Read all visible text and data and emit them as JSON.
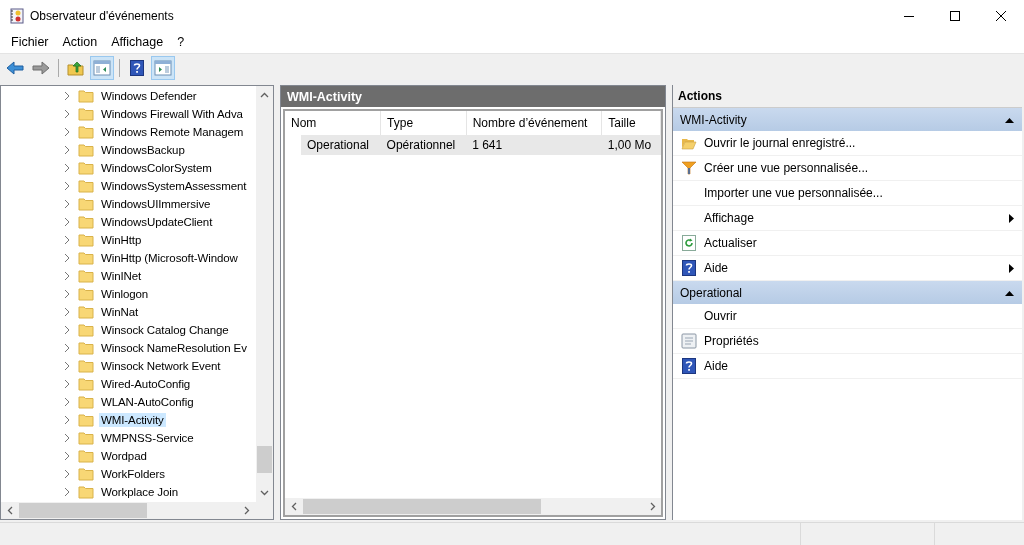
{
  "window": {
    "title": "Observateur d'événements"
  },
  "menu": [
    {
      "label": "Fichier"
    },
    {
      "label": "Action"
    },
    {
      "label": "Affichage"
    },
    {
      "label": "?"
    }
  ],
  "toolbar": [
    {
      "kind": "back"
    },
    {
      "kind": "forward"
    },
    {
      "kind": "separator"
    },
    {
      "kind": "up"
    },
    {
      "kind": "tree",
      "on": true
    },
    {
      "kind": "separator"
    },
    {
      "kind": "help"
    },
    {
      "kind": "pane",
      "on": true
    }
  ],
  "tree": {
    "items": [
      {
        "label": "Windows Defender",
        "expanded": false,
        "selected": false
      },
      {
        "label": "Windows Firewall With Adva",
        "expanded": false,
        "selected": false
      },
      {
        "label": "Windows Remote Managem",
        "expanded": false,
        "selected": false
      },
      {
        "label": "WindowsBackup",
        "expanded": false,
        "selected": false
      },
      {
        "label": "WindowsColorSystem",
        "expanded": false,
        "selected": false
      },
      {
        "label": "WindowsSystemAssessment",
        "expanded": false,
        "selected": false
      },
      {
        "label": "WindowsUIImmersive",
        "expanded": false,
        "selected": false
      },
      {
        "label": "WindowsUpdateClient",
        "expanded": false,
        "selected": false
      },
      {
        "label": "WinHttp",
        "expanded": false,
        "selected": false
      },
      {
        "label": "WinHttp (Microsoft-Window",
        "expanded": false,
        "selected": false
      },
      {
        "label": "WinINet",
        "expanded": false,
        "selected": false
      },
      {
        "label": "Winlogon",
        "expanded": false,
        "selected": false
      },
      {
        "label": "WinNat",
        "expanded": false,
        "selected": false
      },
      {
        "label": "Winsock Catalog Change",
        "expanded": false,
        "selected": false
      },
      {
        "label": "Winsock NameResolution Ev",
        "expanded": false,
        "selected": false
      },
      {
        "label": "Winsock Network Event",
        "expanded": false,
        "selected": false
      },
      {
        "label": "Wired-AutoConfig",
        "expanded": false,
        "selected": false
      },
      {
        "label": "WLAN-AutoConfig",
        "expanded": false,
        "selected": false
      },
      {
        "label": "WMI-Activity",
        "expanded": false,
        "selected": true
      },
      {
        "label": "WMPNSS-Service",
        "expanded": false,
        "selected": false
      },
      {
        "label": "Wordpad",
        "expanded": false,
        "selected": false
      },
      {
        "label": "WorkFolders",
        "expanded": false,
        "selected": false
      },
      {
        "label": "Workplace Join",
        "expanded": false,
        "selected": false
      }
    ]
  },
  "center": {
    "title": "WMI-Activity",
    "table": {
      "columns": [
        "Nom",
        "Type",
        "Nombre d’événement",
        "Taille"
      ],
      "rows": [
        {
          "cells": [
            "Operational",
            "Opérationnel",
            "1 641",
            "1,00 Mo"
          ],
          "selected": true
        }
      ]
    }
  },
  "actions": {
    "title": "Actions",
    "sections": [
      {
        "title": "WMI-Activity",
        "expanded": true,
        "items": [
          {
            "label": "Ouvrir le journal enregistré...",
            "kind": "folder",
            "submenu": false
          },
          {
            "label": "Créer une vue personnalisée...",
            "kind": "filter",
            "submenu": false
          },
          {
            "label": "Importer une vue personnalisée...",
            "kind": "plain",
            "submenu": false
          },
          {
            "label": "Affichage",
            "kind": "plain",
            "submenu": true
          },
          {
            "label": "Actualiser",
            "kind": "refresh",
            "submenu": false
          },
          {
            "label": "Aide",
            "kind": "help",
            "submenu": true
          }
        ]
      },
      {
        "title": "Operational",
        "expanded": true,
        "items": [
          {
            "label": "Ouvrir",
            "kind": "plain",
            "submenu": false
          },
          {
            "label": "Propriétés",
            "kind": "properties",
            "submenu": false
          },
          {
            "label": "Aide",
            "kind": "help",
            "submenu": false
          }
        ]
      }
    ]
  }
}
